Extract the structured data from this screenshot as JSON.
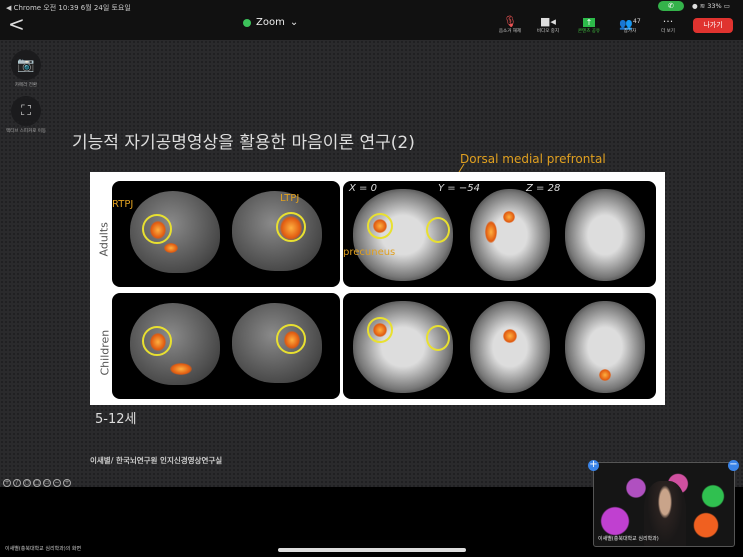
{
  "statusbar": {
    "text": "◀ Chrome  오전 10:39  6월 24일 토요일",
    "battery": "33%"
  },
  "header": {
    "title": "Zoom",
    "back": "<"
  },
  "toolbar": {
    "mute": "음소거 해제",
    "video": "비디오 중지",
    "share": "콘텐츠 공유",
    "participants": "참가자",
    "participants_count": "47",
    "more": "더 보기",
    "leave": "나가기"
  },
  "side": {
    "camera": "카메라 전환",
    "speaker": "액티브 스피커로 이동"
  },
  "slide": {
    "title": "기능적 자기공명영상을 활용한 마음이론 연구(2)",
    "dmpfc": "Dorsal medial prefrontal",
    "figure": {
      "adults": "Adults",
      "children": "Children",
      "rtpj": "RTPJ",
      "ltpj": "LTPJ",
      "precuneus": "precuneus",
      "x": "X = 0",
      "y": "Y = −54",
      "z": "Z = 28"
    },
    "age": "5-12세",
    "credit": "이새별/ 한국뇌연구원 인지신경영상연구실"
  },
  "my_name": "이새별(충북대학교 심리학과)의 화면",
  "video": {
    "name": "이새별(충북대학교 심리학과)"
  },
  "colors": {
    "accent": "#e0a020",
    "leave": "#e0332f",
    "ring": "#e8e030"
  }
}
